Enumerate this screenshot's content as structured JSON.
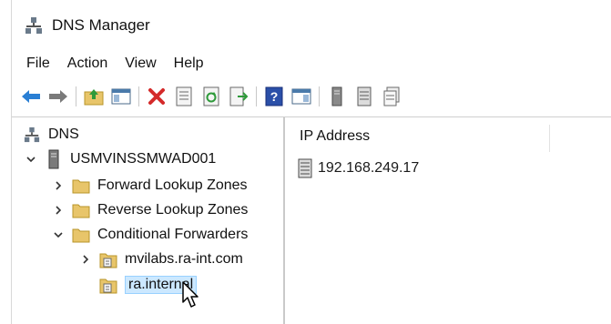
{
  "window": {
    "title": "DNS Manager",
    "icon": "dns-manager-icon"
  },
  "menu": [
    "File",
    "Action",
    "View",
    "Help"
  ],
  "toolbar": {
    "buttons": [
      "back-icon",
      "forward-icon",
      "up-folder-icon",
      "show-hide-console-tree-icon",
      "delete-icon",
      "properties-icon",
      "refresh-icon",
      "export-list-icon",
      "help-icon",
      "show-hide-action-pane-icon",
      "server-icon",
      "zone-icon",
      "forwarders-icon"
    ]
  },
  "tree": {
    "root": "DNS",
    "server": "USMVINSSMWAD001",
    "forward_zones": "Forward Lookup Zones",
    "reverse_zones": "Reverse Lookup Zones",
    "conditional_forwarders": "Conditional Forwarders",
    "forwarder_1": "mvilabs.ra-int.com",
    "forwarder_2": "ra.internal"
  },
  "details": {
    "column_ip": "IP Address",
    "rows": [
      {
        "ip": "192.168.249.17"
      }
    ]
  },
  "colors": {
    "selection": "#cce8ff",
    "selection_border": "#99d1ff",
    "folder": "#e8c56a",
    "nav_arrow": "#2a7fd4",
    "delete": "#d42a2a"
  }
}
